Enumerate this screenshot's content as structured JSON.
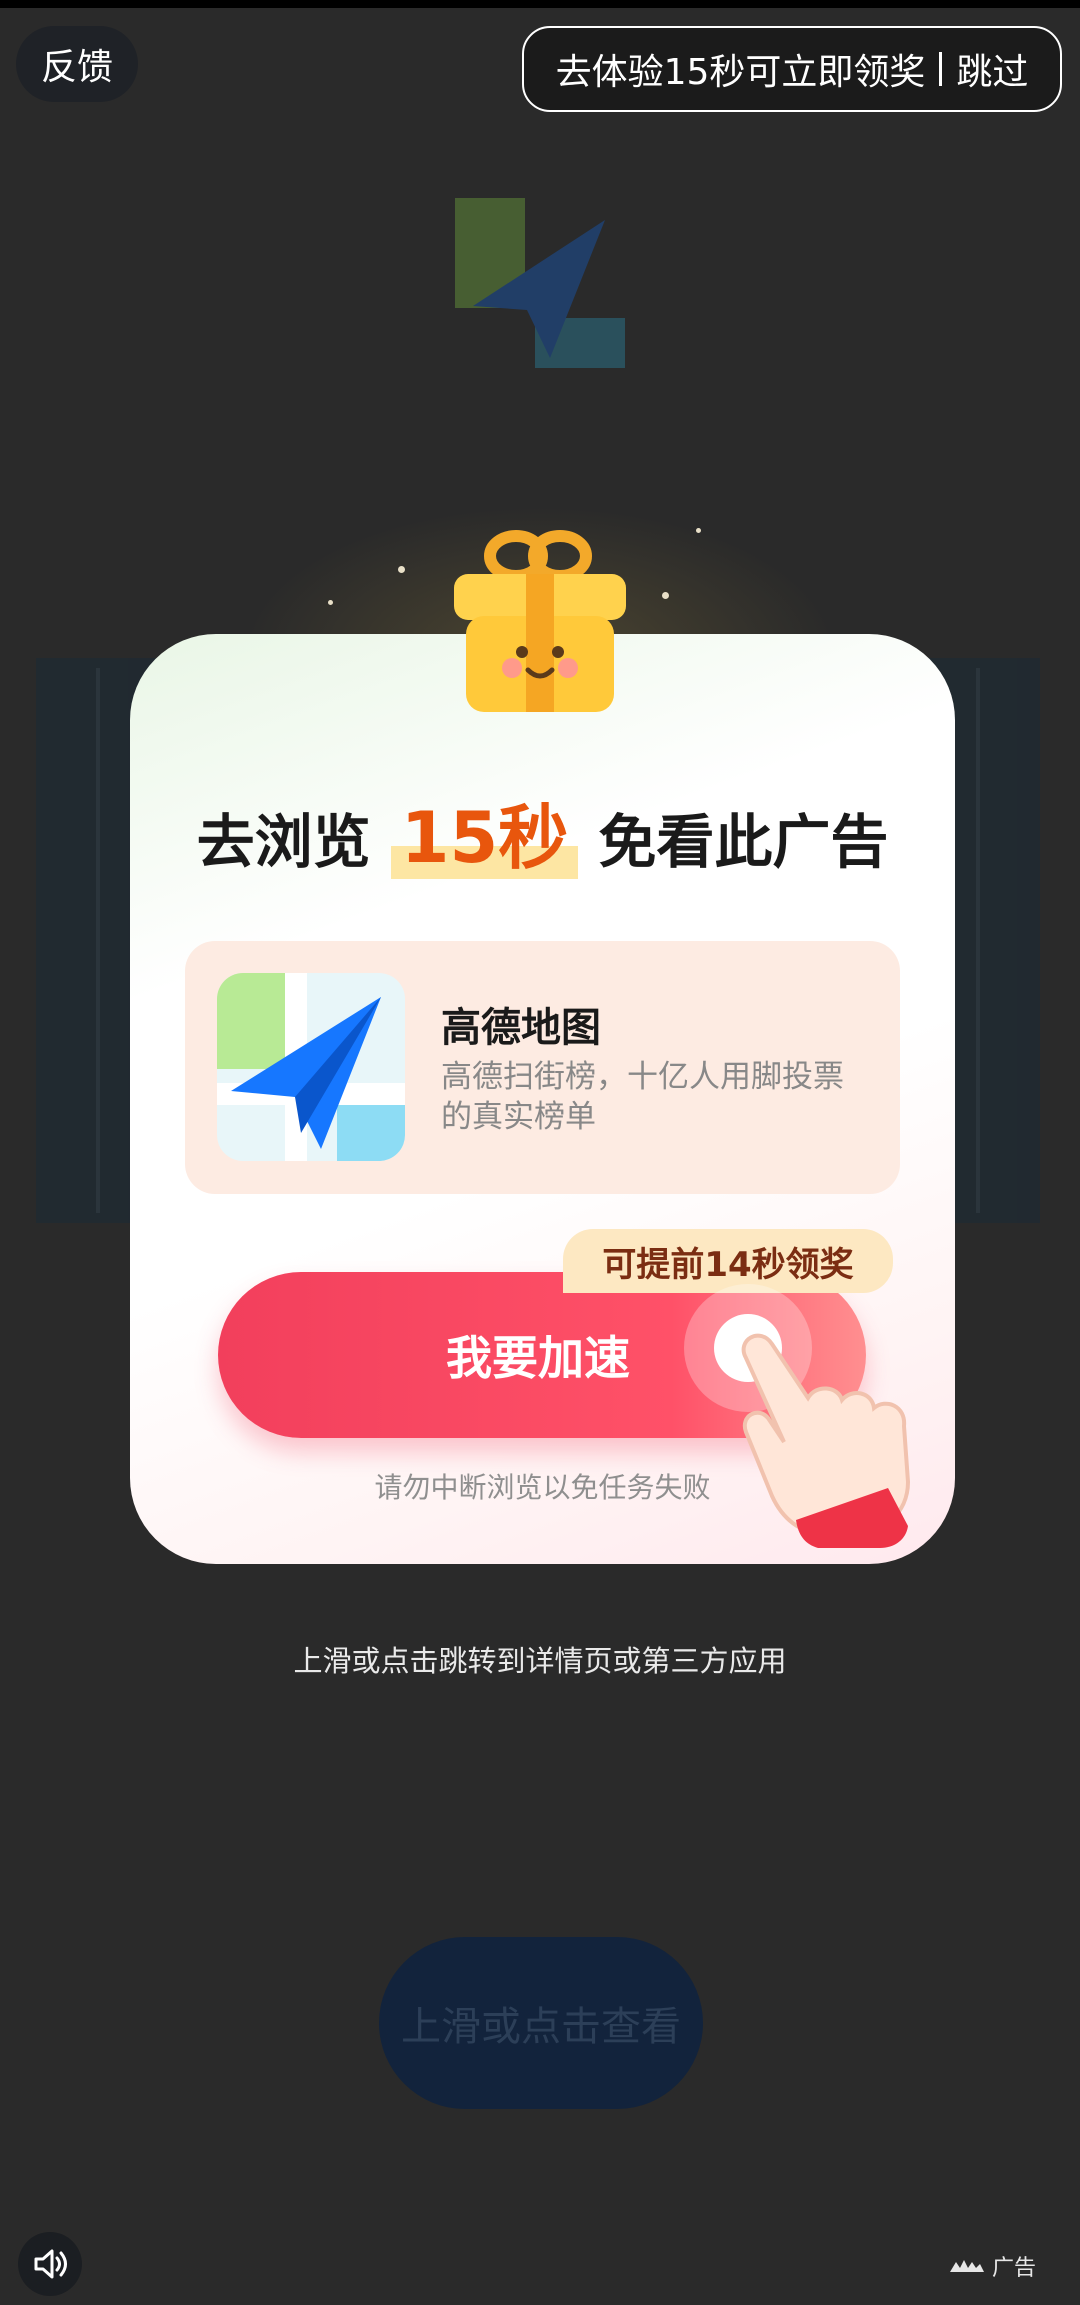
{
  "topbar": {
    "feedback_label": "反馈",
    "skip_text": "去体验15秒可立即领奖",
    "skip_label": "跳过"
  },
  "dialog": {
    "title_prefix": "去浏览",
    "title_highlight": "15秒",
    "title_suffix": "免看此广告",
    "app_name": "高德地图",
    "app_desc": "高德扫街榜，十亿人用脚投票的真实榜单",
    "badge_text": "可提前14秒领奖",
    "speed_button_label": "我要加速",
    "hint_text": "请勿中断浏览以免任务失败"
  },
  "page": {
    "jump_text": "上滑或点击跳转到详情页或第三方应用",
    "view_button_label": "上滑或点击查看",
    "ad_label": "广告"
  },
  "colors": {
    "accent": "#f23f5c",
    "highlight": "#e8560d",
    "badge_bg": "#fde8c2",
    "card_bg": "#fdebe2"
  },
  "icons": {
    "app_icon": "paper-plane-icon",
    "gift": "gift-box-icon",
    "hand": "pointing-hand-icon",
    "sound": "speaker-icon"
  }
}
